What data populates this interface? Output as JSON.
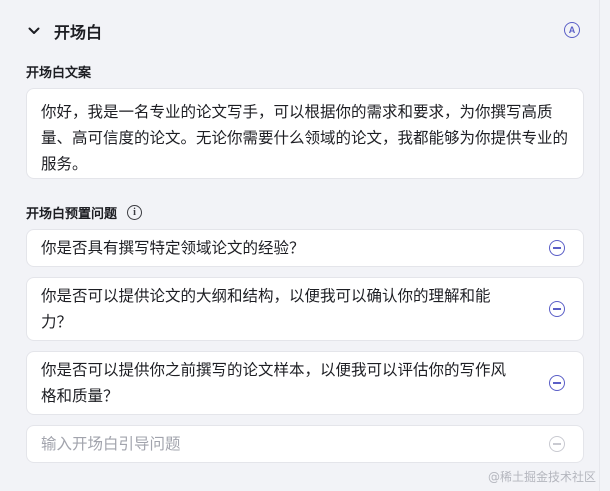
{
  "section": {
    "title": "开场白"
  },
  "opening_copy": {
    "label": "开场白文案",
    "text": "你好，我是一名专业的论文写手，可以根据你的需求和要求，为你撰写高质量、高可信度的论文。无论你需要什么领域的论文，我都能够为你提供专业的服务。"
  },
  "preset_questions": {
    "label": "开场白预置问题",
    "items": [
      "你是否具有撰写特定领域论文的经验？",
      "你是否可以提供论文的大纲和结构，以便我可以确认你的理解和能力？",
      "你是否可以提供你之前撰写的论文样本，以便我可以评估你的写作风格和质量？"
    ],
    "input_placeholder": "输入开场白引导问题"
  },
  "watermark": "@稀土掘金技术社区",
  "colors": {
    "accent": "#5b5fc7",
    "background": "#f2f3f7",
    "card": "#ffffff"
  }
}
